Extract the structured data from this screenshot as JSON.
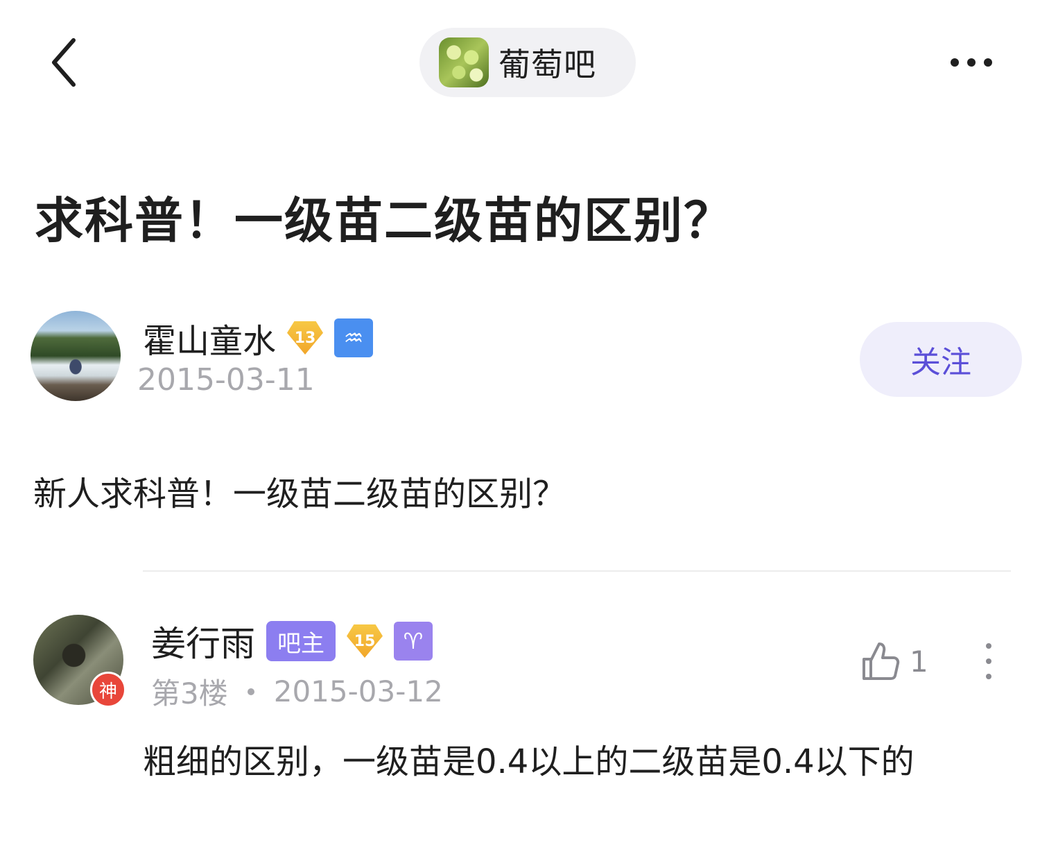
{
  "topbar": {
    "forum_name": "葡萄吧"
  },
  "post": {
    "title": "求科普！一级苗二级苗的区别？",
    "author": {
      "name": "霍山童水",
      "level": "13",
      "zodiac_symbol": "♒",
      "date": "2015-03-11"
    },
    "follow_label": "关注",
    "body": "新人求科普！一级苗二级苗的区别？"
  },
  "reply": {
    "author": {
      "name": "姜行雨",
      "role_tag": "吧主",
      "level": "15",
      "zodiac_symbol": "♈",
      "avatar_badge": "神"
    },
    "floor": "第3楼",
    "date": "2015-03-12",
    "like_count": "1",
    "body": "粗细的区别，一级苗是0.4以上的二级苗是0.4以下的"
  },
  "colors": {
    "accent": "#5b4fd8",
    "follow_bg": "#efeefb",
    "owner_tag": "#8c7ef0",
    "zodiac_op": "#4a8ff0",
    "zodiac_reply": "#9a83ee",
    "god_badge": "#e8463a",
    "level_badge": "#f1a62a"
  }
}
